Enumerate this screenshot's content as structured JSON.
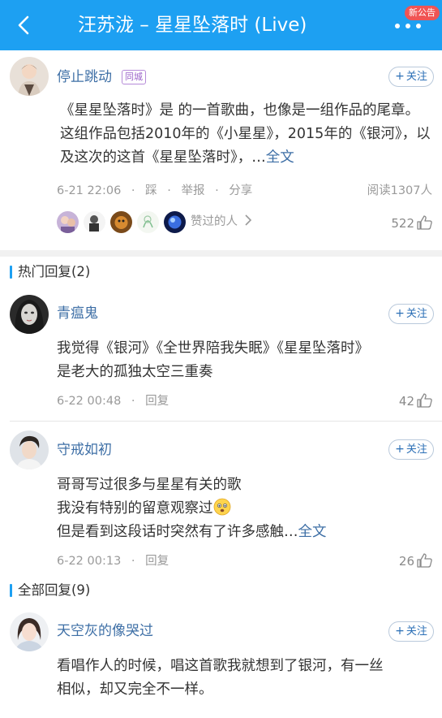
{
  "header": {
    "title": "汪苏泷 – 星星坠落时 (Live)",
    "notice_badge": "新公告"
  },
  "post": {
    "author": "停止跳动",
    "tag": "同城",
    "follow_label": "关注",
    "body": "《星星坠落时》是 的一首歌曲，也像是一组作品的尾章。这组作品包括2010年的《小星星》，2015年的《银河》，以及这次的这首《星星坠落时》，…",
    "fulltext_label": "全文",
    "time": "6-21 22:06",
    "action_dislike": "踩",
    "action_report": "举报",
    "action_share": "分享",
    "reads": "阅读1307人",
    "liked_by_label": "赞过的人",
    "likes": "522"
  },
  "hot": {
    "title": "热门回复(2)",
    "comments": [
      {
        "author": "青瘟鬼",
        "follow_label": "关注",
        "lines": [
          "我觉得《银河》《全世界陪我失眠》《星星坠落时》",
          "是老大的孤独太空三重奏"
        ],
        "time": "6-22 00:48",
        "reply_label": "回复",
        "likes": "42"
      },
      {
        "author": "守戒如初",
        "follow_label": "关注",
        "lines": [
          "哥哥写过很多与星星有关的歌",
          "我没有特别的留意观察过",
          "但是看到这段话时突然有了许多感触…"
        ],
        "fulltext_label": "全文",
        "time": "6-22 00:13",
        "reply_label": "回复",
        "likes": "26"
      }
    ]
  },
  "all": {
    "title": "全部回复(9)",
    "comments": [
      {
        "author": "天空灰的像哭过",
        "follow_label": "关注",
        "lines": [
          "看唱作人的时候，唱这首歌我就想到了银河，有一丝",
          "相似，却又完全不一样。"
        ]
      }
    ]
  },
  "colors": {
    "header": "#1da0f2",
    "link": "#3e6fa6",
    "badge_red": "#f05454"
  },
  "icons": [
    "back-arrow-icon",
    "more-dots-icon",
    "thumbs-up-icon",
    "chevron-right-icon",
    "worried-face-emoji-icon"
  ]
}
